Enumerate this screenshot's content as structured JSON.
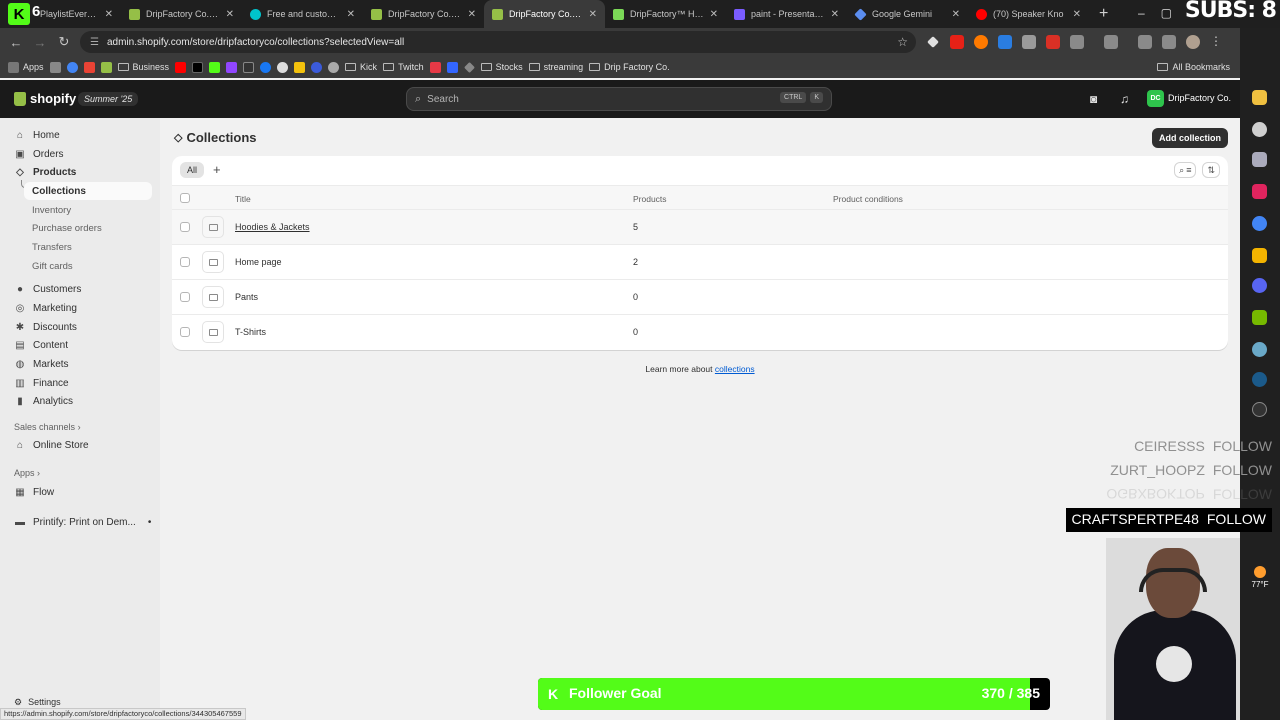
{
  "browser": {
    "kick_count": "6",
    "subs_overlay": "SUBS: 8",
    "tabs": [
      {
        "label": "PlaylistEver-/: A",
        "color": "#53fc18"
      },
      {
        "label": "DripFactory Co. · Pro",
        "color": "#95bf47"
      },
      {
        "label": "Free and customizab",
        "color": "#00c4cc"
      },
      {
        "label": "DripFactory Co. · Cus",
        "color": "#95bf47"
      },
      {
        "label": "DripFactory Co. · Col",
        "color": "#95bf47"
      },
      {
        "label": "DripFactory™ Hoodie",
        "color": "#7bd957"
      },
      {
        "label": "paint - Presentation",
        "color": "#7a5cff"
      },
      {
        "label": "Google Gemini",
        "color": "#5b8def"
      },
      {
        "label": "(70) Speaker Kno",
        "color": "#ff0000"
      }
    ],
    "url": "admin.shopify.com/store/dripfactoryco/collections?selectedView=all",
    "bookmarks": {
      "apps": "Apps",
      "business": "Business",
      "kick": "Kick",
      "twitch": "Twitch",
      "stocks": "Stocks",
      "streaming": "streaming",
      "drip": "Drip Factory Co.",
      "all": "All Bookmarks"
    },
    "status_url": "https://admin.shopify.com/store/dripfactoryco/collections/344305467559"
  },
  "shopify": {
    "logo": "shopify",
    "edition": "Summer '25",
    "search_placeholder": "Search",
    "kbd_ctrl": "CTRL",
    "kbd_k": "K",
    "store_initials": "DC",
    "store_name": "DripFactory Co."
  },
  "sidebar": {
    "home": "Home",
    "orders": "Orders",
    "products": "Products",
    "collections": "Collections",
    "inventory": "Inventory",
    "purchase_orders": "Purchase orders",
    "transfers": "Transfers",
    "gift_cards": "Gift cards",
    "customers": "Customers",
    "marketing": "Marketing",
    "discounts": "Discounts",
    "content": "Content",
    "markets": "Markets",
    "finance": "Finance",
    "analytics": "Analytics",
    "sales_channels": "Sales channels",
    "online_store": "Online Store",
    "apps": "Apps",
    "flow": "Flow",
    "printify": "Printify: Print on Dem...",
    "settings": "Settings"
  },
  "main": {
    "title": "Collections",
    "add_button": "Add collection",
    "tab_all": "All",
    "columns": {
      "title": "Title",
      "products": "Products",
      "conditions": "Product conditions"
    },
    "rows": [
      {
        "title": "Hoodies & Jackets",
        "products": "5"
      },
      {
        "title": "Home page",
        "products": "2"
      },
      {
        "title": "Pants",
        "products": "0"
      },
      {
        "title": "T-Shirts",
        "products": "0"
      }
    ],
    "learn_text": "Learn more about",
    "learn_link": "collections"
  },
  "overlay": {
    "followers": [
      {
        "name": "CEIRESSS",
        "action": "FOLLOW"
      },
      {
        "name": "ZURT_HOOPZ",
        "action": "FOLLOW"
      },
      {
        "name": "OGBXBOKTOP",
        "action": "FOLLOW"
      },
      {
        "name": "CRAFTSPERTPE48",
        "action": "FOLLOW"
      }
    ],
    "goal_label": "Follower Goal",
    "goal_count": "370 / 385",
    "goal_fraction": 0.961
  },
  "dock": {
    "temperature": "77°F"
  }
}
